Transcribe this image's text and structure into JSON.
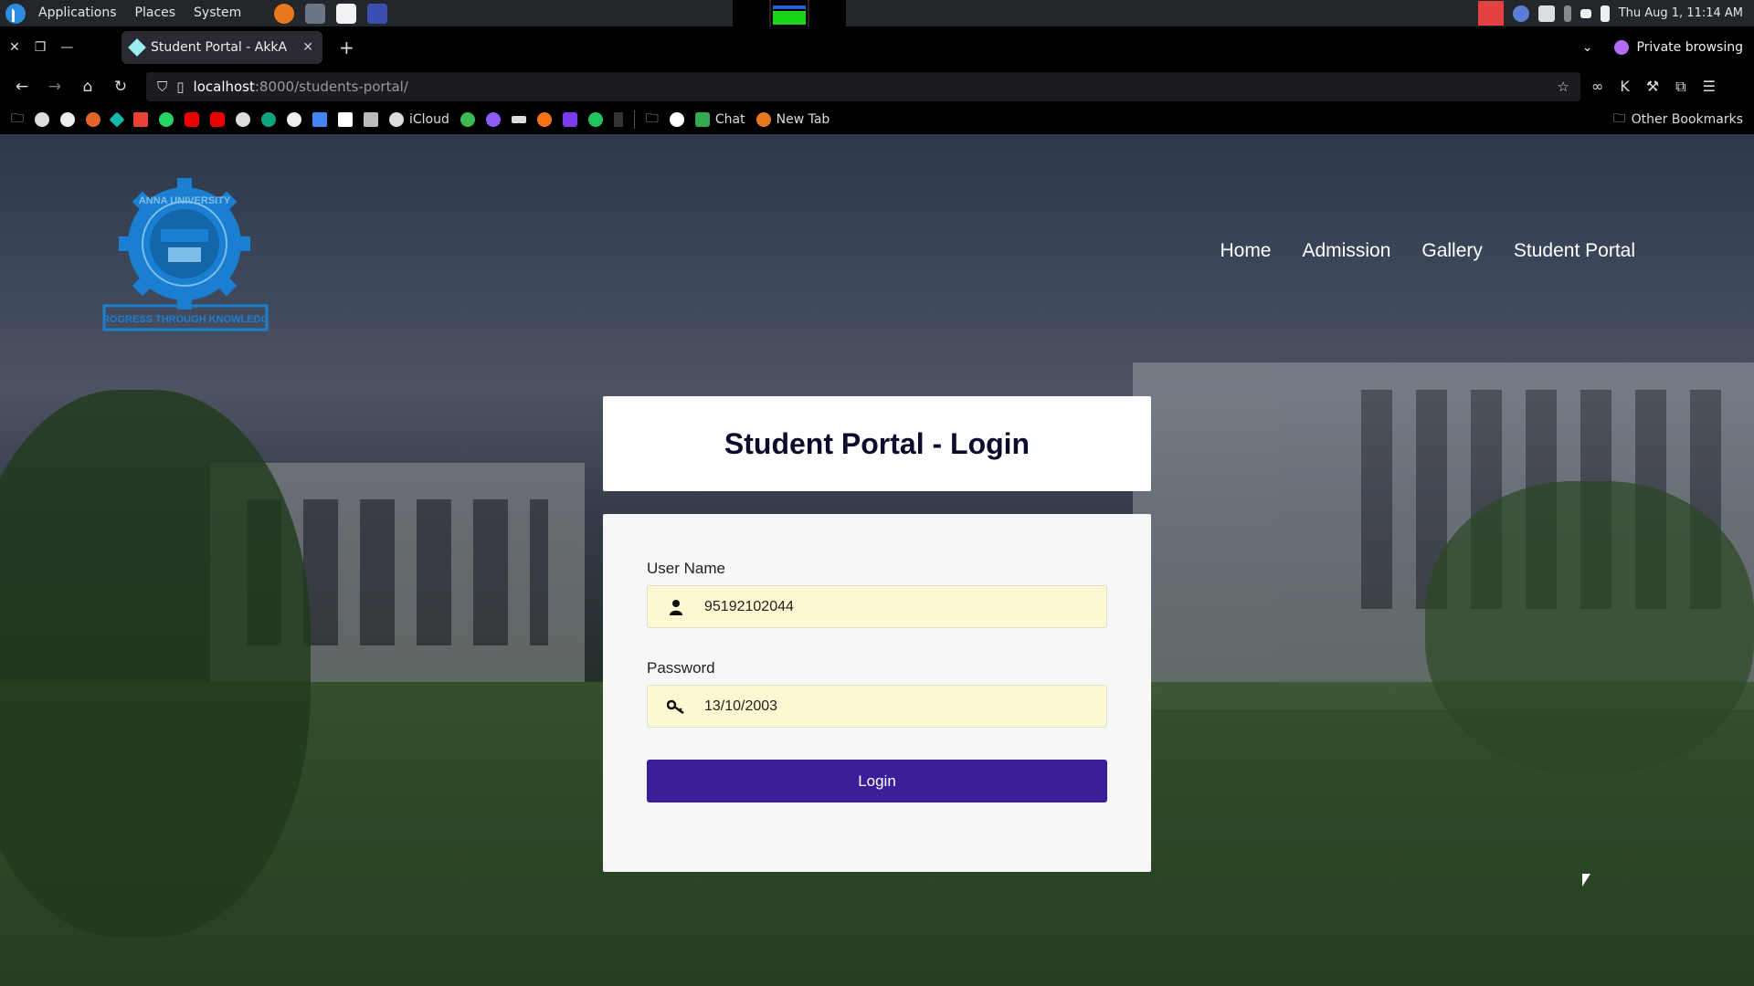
{
  "os": {
    "menu": [
      "Applications",
      "Places",
      "System"
    ],
    "clock": "Thu Aug  1, 11:14 AM"
  },
  "browser": {
    "tab_title": "Student Portal - AkkA",
    "url_host": "localhost",
    "url_path": ":8000/students-portal/",
    "private_label": "Private browsing",
    "bookmarks": {
      "icloud": "iCloud",
      "chat": "Chat",
      "new_tab": "New Tab",
      "other": "Other Bookmarks"
    }
  },
  "site": {
    "logo_ring_text": "ANNA UNIVERSITY",
    "logo_banner": "PROGRESS THROUGH KNOWLEDGE",
    "nav": [
      "Home",
      "Admission",
      "Gallery",
      "Student Portal"
    ]
  },
  "login": {
    "title": "Student Portal - Login",
    "username_label": "User Name",
    "username_value": "95192102044",
    "password_label": "Password",
    "password_value": "13/10/2003",
    "button": "Login"
  },
  "colors": {
    "button": "#3b1f9a",
    "input_bg": "#fbf8d2",
    "logo": "#1a7fd0"
  }
}
